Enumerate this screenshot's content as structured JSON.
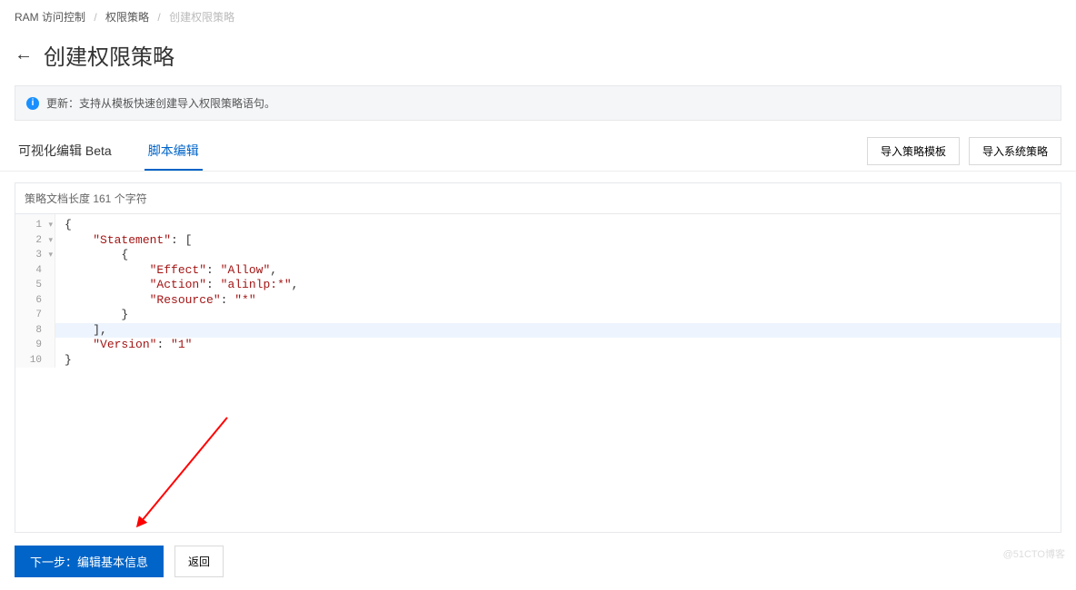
{
  "breadcrumb": {
    "item0": "RAM 访问控制",
    "item1": "权限策略",
    "item2": "创建权限策略"
  },
  "page": {
    "title": "创建权限策略"
  },
  "banner": {
    "text": "更新：支持从模板快速创建导入权限策略语句。"
  },
  "tabs": {
    "visual": "可视化编辑 Beta",
    "script": "脚本编辑"
  },
  "actions": {
    "import_template": "导入策略模板",
    "import_system": "导入系统策略"
  },
  "editor": {
    "char_count_label": "策略文档长度 161 个字符",
    "code": {
      "l1": "{",
      "l2a": "    ",
      "l2k": "\"Statement\"",
      "l2b": ": [",
      "l3": "        {",
      "l4a": "            ",
      "l4k": "\"Effect\"",
      "l4b": ": ",
      "l4v": "\"Allow\"",
      "l4c": ",",
      "l5a": "            ",
      "l5k": "\"Action\"",
      "l5b": ": ",
      "l5v": "\"alinlp:*\"",
      "l5c": ",",
      "l6a": "            ",
      "l6k": "\"Resource\"",
      "l6b": ": ",
      "l6v": "\"*\"",
      "l7": "        }",
      "l8": "    ],",
      "l9a": "    ",
      "l9k": "\"Version\"",
      "l9b": ": ",
      "l9v": "\"1\"",
      "l10": "}"
    }
  },
  "footer": {
    "next": "下一步：编辑基本信息",
    "back": "返回"
  },
  "watermark": "@51CTO博客"
}
